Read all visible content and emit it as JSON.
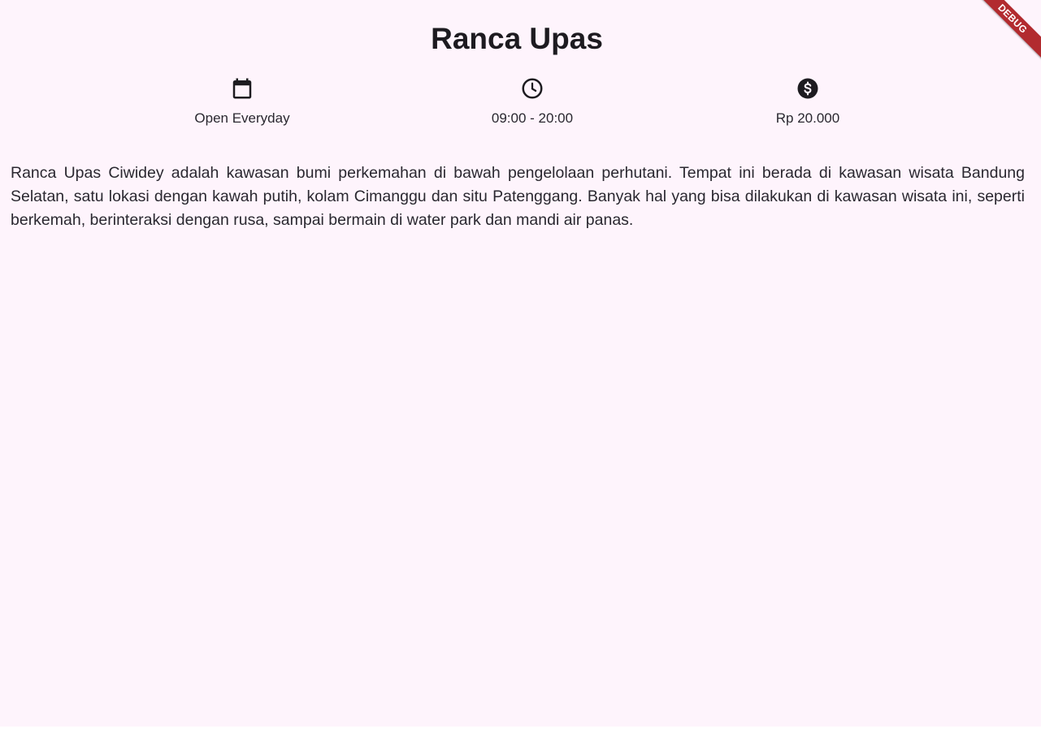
{
  "place": {
    "title": "Ranca Upas",
    "description": "Ranca Upas Ciwidey adalah kawasan bumi perkemahan di bawah pengelolaan perhutani. Tempat ini berada di kawasan wisata Bandung Selatan, satu lokasi dengan kawah putih, kolam Cimanggu dan situ Patenggang. Banyak hal yang bisa dilakukan di kawasan wisata ini, seperti berkemah, berinteraksi dengan rusa, sampai bermain di water park dan mandi air panas."
  },
  "info": {
    "days": {
      "icon": "calendar-icon",
      "label": "Open Everyday"
    },
    "hours": {
      "icon": "clock-icon",
      "label": "09:00 - 20:00"
    },
    "price": {
      "icon": "dollar-icon",
      "label": "Rp 20.000"
    }
  },
  "debug_banner": {
    "label": "DEBUG",
    "color": "#b22b2f"
  },
  "colors": {
    "background": "#fef4fc",
    "text": "#1d1b20"
  }
}
